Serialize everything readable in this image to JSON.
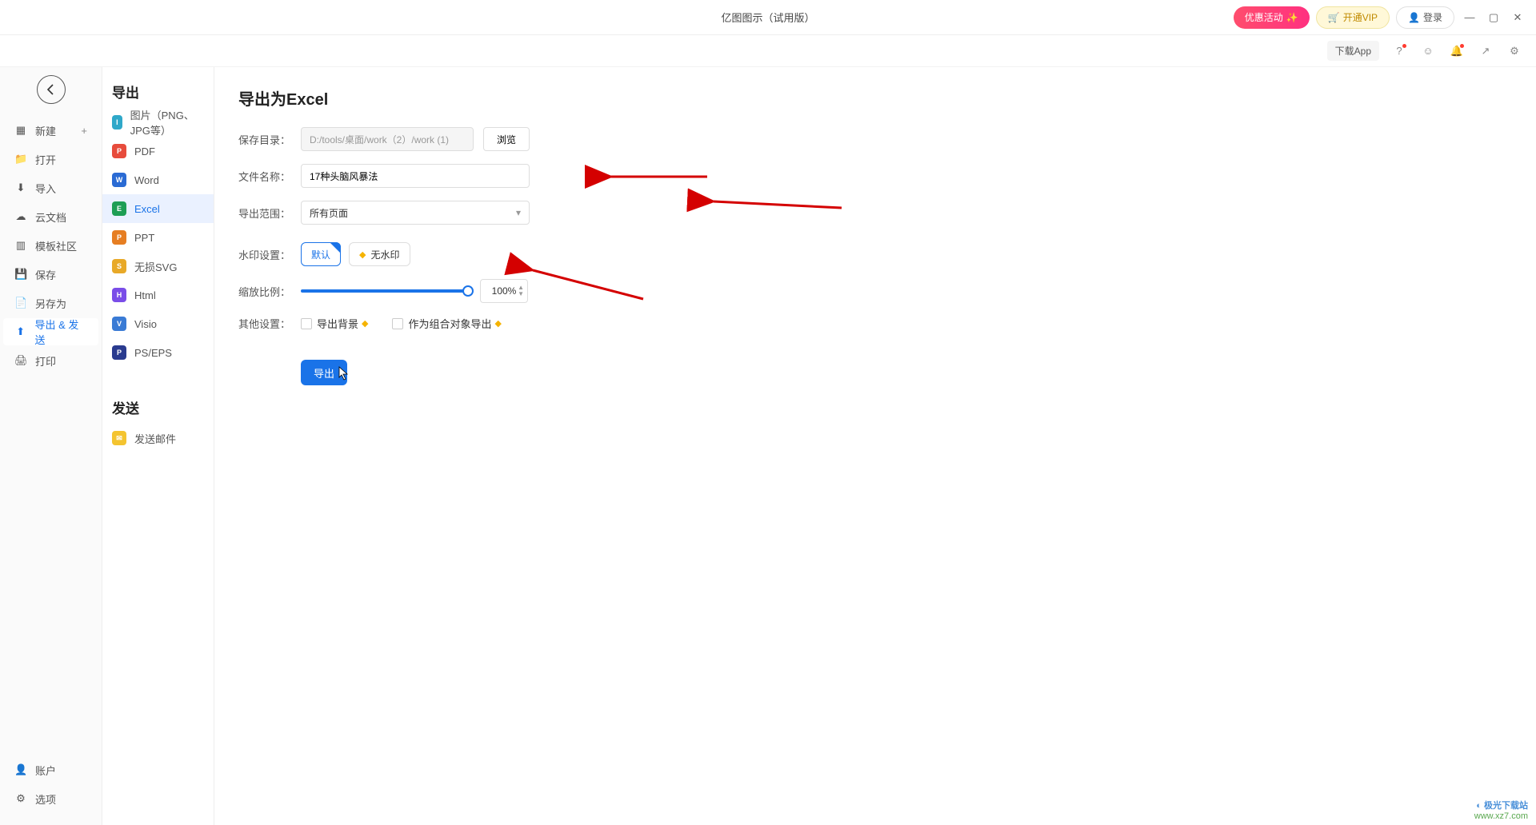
{
  "window": {
    "title": "亿图图示（试用版）",
    "buttons": {
      "download_app": "下载App",
      "promo": "优惠活动",
      "vip": "开通VIP",
      "login": "登录"
    }
  },
  "nav1": {
    "items": [
      {
        "key": "new",
        "label": "新建",
        "plus": true
      },
      {
        "key": "open",
        "label": "打开"
      },
      {
        "key": "import",
        "label": "导入"
      },
      {
        "key": "cloud",
        "label": "云文档"
      },
      {
        "key": "templates",
        "label": "模板社区"
      },
      {
        "key": "save",
        "label": "保存"
      },
      {
        "key": "saveas",
        "label": "另存为"
      },
      {
        "key": "export",
        "label": "导出 & 发送",
        "active": true
      },
      {
        "key": "print",
        "label": "打印"
      }
    ],
    "bottom": [
      {
        "key": "account",
        "label": "账户"
      },
      {
        "key": "options",
        "label": "选项"
      }
    ]
  },
  "export": {
    "section_export": "导出",
    "section_send": "发送",
    "formats": [
      {
        "key": "image",
        "label": "图片（PNG、JPG等）",
        "color": "#2fa8c9"
      },
      {
        "key": "pdf",
        "label": "PDF",
        "color": "#e74c3c"
      },
      {
        "key": "word",
        "label": "Word",
        "color": "#2a6bd4"
      },
      {
        "key": "excel",
        "label": "Excel",
        "color": "#1e9e54",
        "active": true
      },
      {
        "key": "ppt",
        "label": "PPT",
        "color": "#e67e22"
      },
      {
        "key": "svg",
        "label": "无损SVG",
        "color": "#e8a928"
      },
      {
        "key": "html",
        "label": "Html",
        "color": "#7a4de8"
      },
      {
        "key": "visio",
        "label": "Visio",
        "color": "#3a7bd5"
      },
      {
        "key": "ps",
        "label": "PS/EPS",
        "color": "#2a3b8f"
      }
    ],
    "send_items": [
      {
        "key": "mail",
        "label": "发送邮件",
        "color": "#f4c430"
      }
    ]
  },
  "form": {
    "title": "导出为Excel",
    "labels": {
      "path": "保存目录：",
      "filename": "文件名称：",
      "scope": "导出范围：",
      "watermark": "水印设置：",
      "scale": "缩放比例：",
      "other": "其他设置："
    },
    "path_value": "D:/tools/桌面/work（2）/work (1)",
    "browse": "浏览",
    "filename_value": "17种头脑风暴法",
    "scope_value": "所有页面",
    "wm_default": "默认",
    "wm_none": "无水印",
    "scale_value": "100%",
    "chk_bg": "导出背景",
    "chk_group": "作为组合对象导出",
    "export_btn": "导出"
  },
  "watermark": {
    "site": "极光下载站",
    "url": "www.xz7.com"
  }
}
